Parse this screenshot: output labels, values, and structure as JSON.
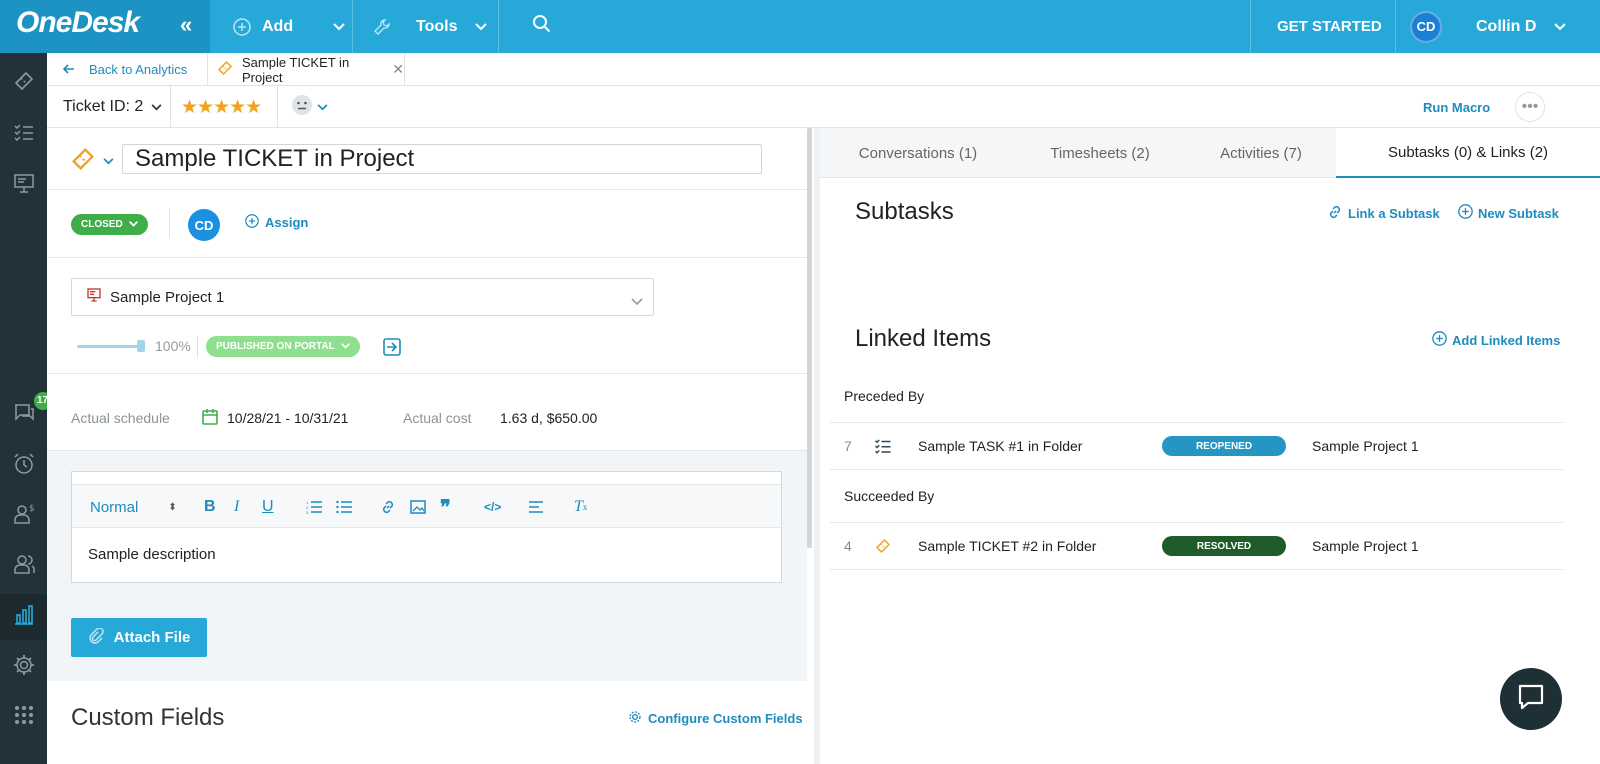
{
  "topbar": {
    "logo": "OneDesk",
    "add_label": "Add",
    "tools_label": "Tools",
    "get_started_label": "GET STARTED",
    "user_initials": "CD",
    "user_name": "Collin D"
  },
  "rail": {
    "badge_count": "17"
  },
  "tabs": {
    "back_label": "Back to Analytics",
    "doc_tab_label": "Sample TICKET in Project"
  },
  "ticket_header": {
    "ticket_id": "Ticket ID: 2",
    "stars": "★★★★★",
    "rating": 5,
    "run_macro": "Run Macro"
  },
  "ticket": {
    "title": "Sample TICKET in Project",
    "status": "CLOSED",
    "assignee_initials": "CD",
    "assign_label": "Assign",
    "project": "Sample Project 1",
    "progress_label": "100%",
    "progress": 1.0,
    "portal_status": "PUBLISHED ON PORTAL",
    "schedule_label": "Actual schedule",
    "schedule_value": "10/28/21 - 10/31/21",
    "cost_label": "Actual cost",
    "cost_value": "1.63 d, $650.00"
  },
  "editor": {
    "format": "Normal",
    "content": "Sample description",
    "attach_label": "Attach File"
  },
  "custom_fields": {
    "title": "Custom Fields",
    "configure_label": "Configure Custom Fields"
  },
  "right": {
    "tabs": [
      {
        "label": "Conversations (1)"
      },
      {
        "label": "Timesheets (2)"
      },
      {
        "label": "Activities (7)"
      },
      {
        "label": "Subtasks (0) & Links (2)"
      }
    ],
    "subtasks_title": "Subtasks",
    "link_subtask": "Link a Subtask",
    "new_subtask": "New Subtask",
    "linked_title": "Linked Items",
    "add_linked": "Add Linked Items",
    "preceded_label": "Preceded By",
    "succeeded_label": "Succeeded By",
    "preceded": {
      "num": "7",
      "name": "Sample TASK #1 in Folder",
      "status": "REOPENED",
      "project": "Sample Project 1"
    },
    "succeeded": {
      "num": "4",
      "name": "Sample TICKET #2 in Folder",
      "status": "RESOLVED",
      "project": "Sample Project 1"
    }
  },
  "colors": {
    "brand": "#26a9d9",
    "closed": "#3fae49",
    "reopened": "#2596c4",
    "resolved": "#1f5c2a",
    "ticket_icon": "#f3a21b"
  }
}
